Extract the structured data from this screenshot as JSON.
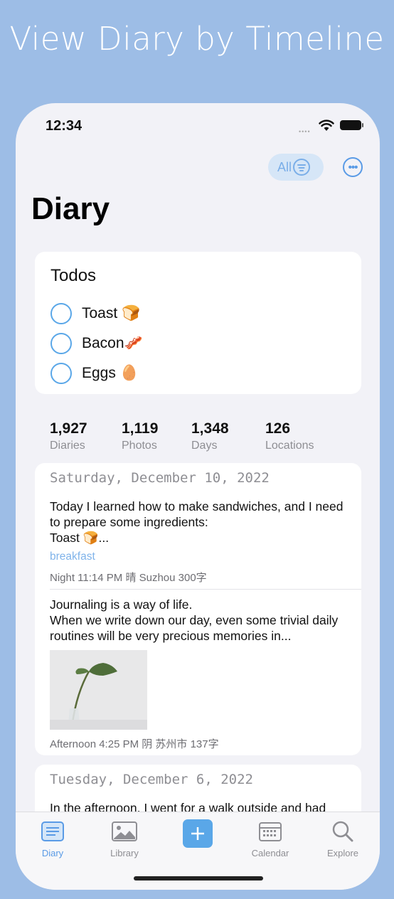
{
  "headline": "View Diary by Timeline",
  "status": {
    "time": "12:34"
  },
  "header": {
    "filter_label": "All",
    "title": "Diary"
  },
  "todos": {
    "title": "Todos",
    "items": [
      {
        "label": "Toast 🍞"
      },
      {
        "label": "Bacon🥓"
      },
      {
        "label": "Eggs 🥚"
      }
    ]
  },
  "stats": [
    {
      "value": "1,927",
      "label": "Diaries"
    },
    {
      "value": "1,119",
      "label": "Photos"
    },
    {
      "value": "1,348",
      "label": "Days"
    },
    {
      "value": "126",
      "label": "Locations"
    }
  ],
  "entries": [
    {
      "date": "Saturday, December 10, 2022",
      "text": "Today I learned how to make sandwiches, and I need to prepare some ingredients:\nToast 🍞...",
      "tag": "breakfast",
      "meta": "Night 11:14 PM  晴  Suzhou  300字"
    },
    {
      "text": "Journaling is a way of life.\nWhen we write down our day, even some trivial daily routines will be very precious memories in...",
      "meta": "Afternoon 4:25 PM  阴  苏州市  137字"
    },
    {
      "date": "Tuesday, December 6, 2022",
      "text": "In the afternoon, I went for a walk outside and had"
    }
  ],
  "tabs": [
    {
      "label": "Diary"
    },
    {
      "label": "Library"
    },
    {
      "label": "Calendar"
    },
    {
      "label": "Explore"
    }
  ],
  "colors": {
    "accent": "#5aa7e8",
    "background": "#9dbde6"
  }
}
